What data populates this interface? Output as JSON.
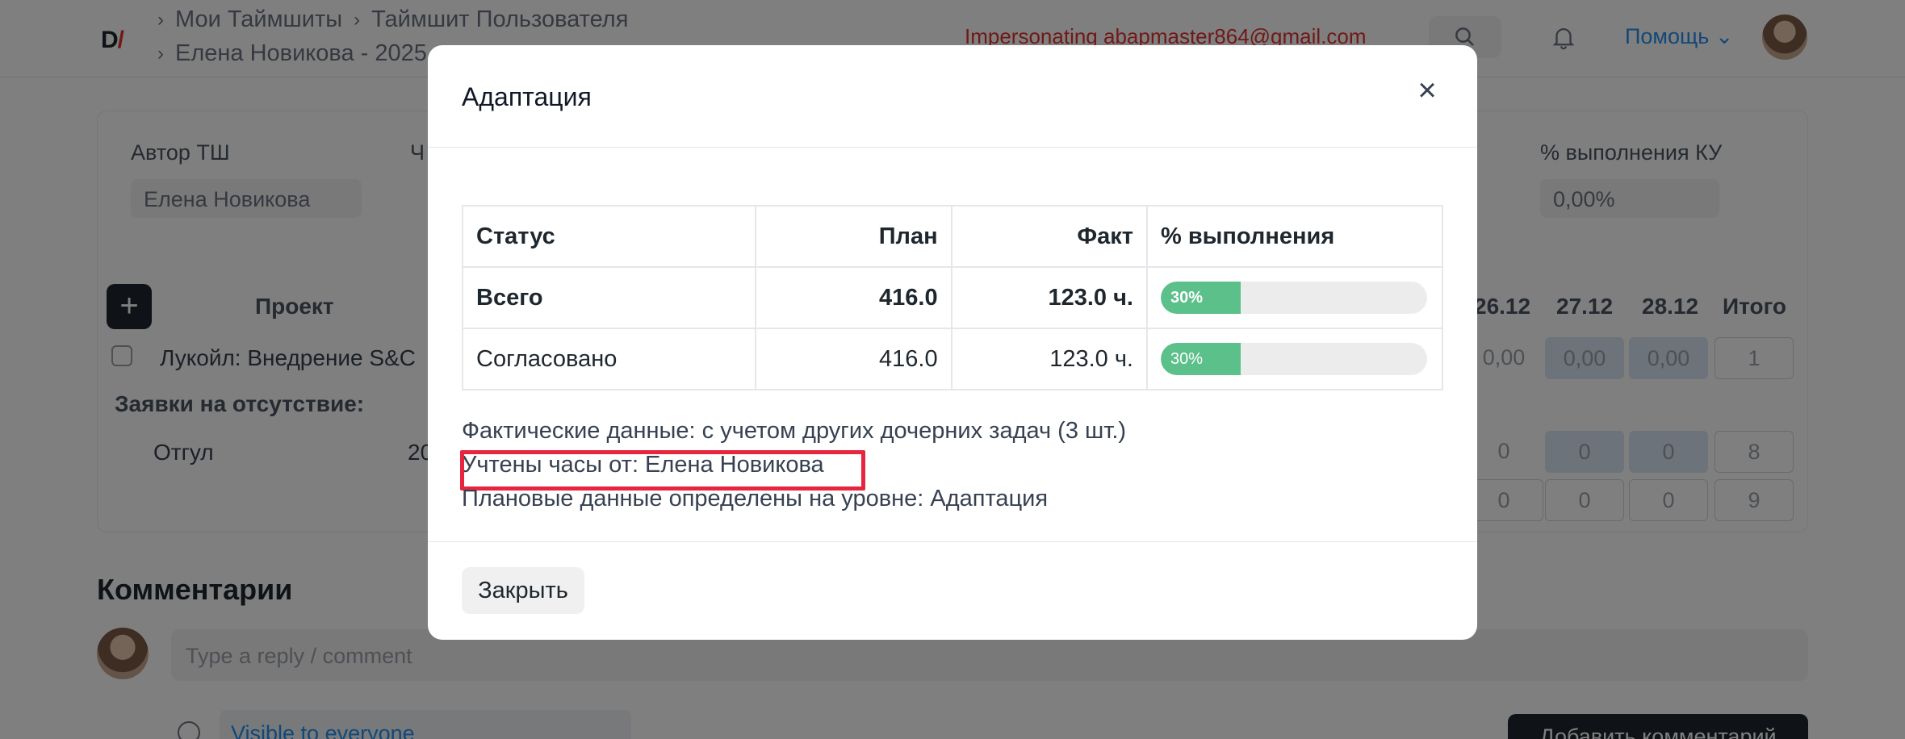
{
  "header": {
    "logo_left": "D",
    "logo_right": "/",
    "breadcrumbs": [
      "Мои Таймшиты",
      "Таймшит Пользователя",
      "Елена Новикова - 2025"
    ],
    "impersonating": "Impersonating abapmaster864@gmail.com",
    "help_label": "Помощь"
  },
  "timesheet": {
    "author_label": "Автор ТШ",
    "author_value": "Елена Новикова",
    "col2_label_partial": "Ч",
    "ku_label": "% выполнения КУ",
    "ku_value": "0,00%",
    "columns": {
      "project": "Проект",
      "d1": "26.12",
      "d2": "27.12",
      "d3": "28.12",
      "total": "Итого"
    },
    "rows": [
      {
        "name": "Лукойл: Внедрение S&C",
        "v1": "0,00",
        "v2": "0,00",
        "v3": "0,00",
        "total": "1"
      },
      {
        "name": "Отгул",
        "date": "20",
        "v1": "0",
        "v2": "0",
        "v3": "0",
        "total": "8"
      },
      {
        "name": "",
        "v1": "0",
        "v2": "0",
        "v3": "0",
        "total": "9"
      }
    ],
    "absence_label": "Заявки на отсутствие:"
  },
  "comments": {
    "title": "Комментарии",
    "placeholder": "Type a reply / comment",
    "visibility": "Visible to everyone",
    "submit": "Добавить комментарий"
  },
  "modal": {
    "title": "Адаптация",
    "close_icon": "×",
    "table": {
      "headers": {
        "status": "Статус",
        "plan": "План",
        "fact": "Факт",
        "percent": "% выполнения"
      },
      "rows": [
        {
          "status": "Всего",
          "plan": "416.0",
          "fact": "123.0 ч.",
          "percent_label": "30%",
          "percent": 30
        },
        {
          "status": "Согласовано",
          "plan": "416.0",
          "fact": "123.0 ч.",
          "percent_label": "30%",
          "percent": 30
        }
      ]
    },
    "info_actual": "Фактические данные: с учетом других дочерних задач (3 шт.)",
    "info_hours": "Учтены часы от: Елена Новикова",
    "info_plan": "Плановые данные определены на уровне: Адаптация",
    "close_button": "Закрыть"
  },
  "colors": {
    "accent": "#2490ef",
    "progress": "#5bc08a",
    "highlight": "#e8253f",
    "danger": "#e0322f"
  }
}
